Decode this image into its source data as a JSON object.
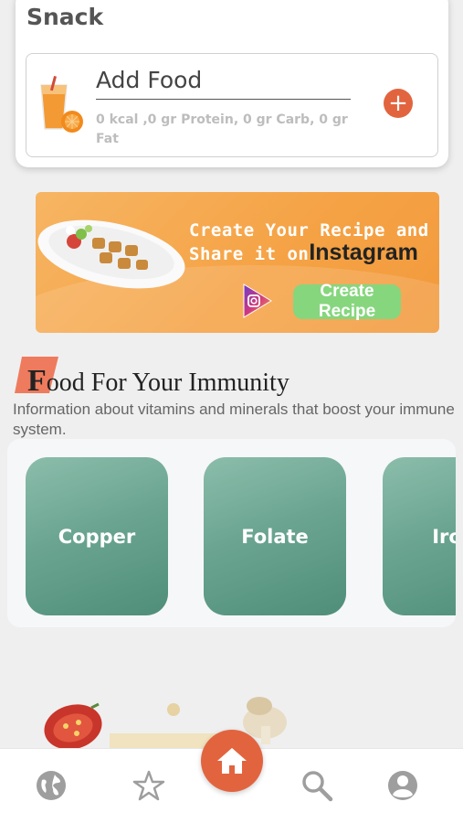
{
  "snack": {
    "title": "Snack",
    "add_food_label": "Add Food",
    "macros": "0 kcal ,0 gr Protein, 0 gr Carb, 0 gr Fat",
    "add_button_symbol": "+"
  },
  "banner": {
    "line1": "Create Your Recipe and",
    "line2": "Share it on",
    "instagram": "Instagram",
    "button_label": "Create Recipe"
  },
  "immunity": {
    "title_first_letter": "F",
    "title_rest": "ood For Your Immunity",
    "subtitle": "Information about vitamins and minerals that boost your immune system.",
    "cards": [
      {
        "label": "Copper"
      },
      {
        "label": "Folate"
      },
      {
        "label": "Iron"
      }
    ]
  },
  "nav": {
    "items": [
      "globe-icon",
      "star-icon",
      "home-icon",
      "search-icon",
      "profile-icon"
    ]
  },
  "colors": {
    "accent": "#e2643f",
    "banner": "#f5a346",
    "button_green": "#86d67e",
    "card_green": "#6ba592"
  }
}
